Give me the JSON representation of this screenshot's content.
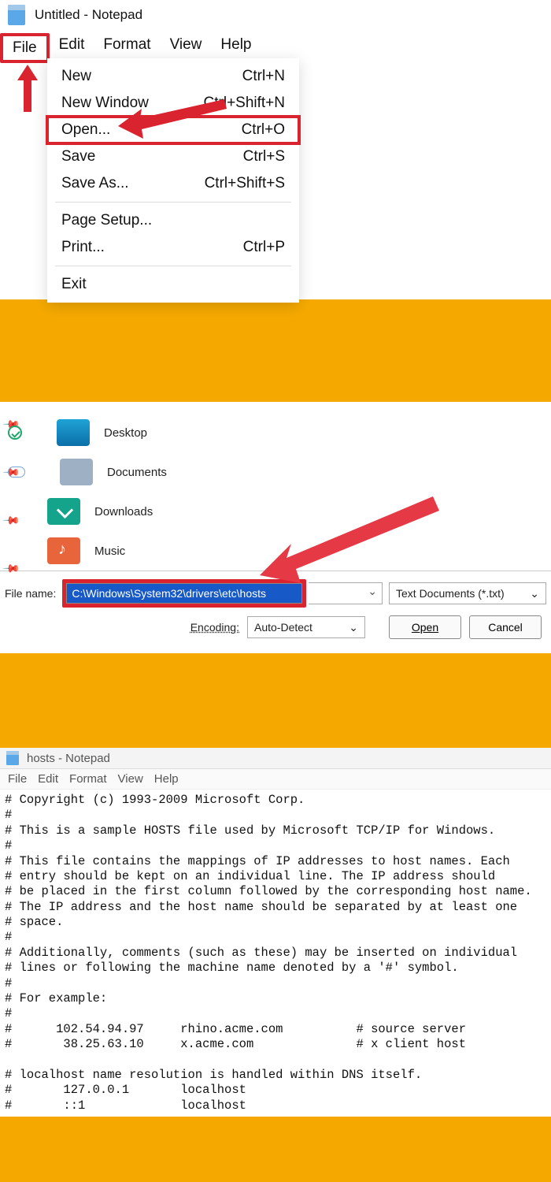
{
  "panel1": {
    "title": "Untitled - Notepad",
    "menubar": [
      "File",
      "Edit",
      "Format",
      "View",
      "Help"
    ],
    "dropdown": [
      {
        "label": "New",
        "accel": "Ctrl+N"
      },
      {
        "label": "New Window",
        "accel": "Ctrl+Shift+N"
      },
      {
        "label": "Open...",
        "accel": "Ctrl+O",
        "highlight": true
      },
      {
        "label": "Save",
        "accel": "Ctrl+S"
      },
      {
        "label": "Save As...",
        "accel": "Ctrl+Shift+S"
      },
      {
        "sep": true
      },
      {
        "label": "Page Setup...",
        "accel": ""
      },
      {
        "label": "Print...",
        "accel": "Ctrl+P"
      },
      {
        "sep": true
      },
      {
        "label": "Exit",
        "accel": ""
      }
    ]
  },
  "panel2": {
    "folders": [
      {
        "name": "Desktop",
        "icon": "f-desktop",
        "badge": "check"
      },
      {
        "name": "Documents",
        "icon": "f-docs",
        "badge": "cloud"
      },
      {
        "name": "Downloads",
        "icon": "f-down"
      },
      {
        "name": "Music",
        "icon": "f-music"
      }
    ],
    "file_name_label": "File name:",
    "file_name_value": "C:\\Windows\\System32\\drivers\\etc\\hosts",
    "type_filter": "Text Documents (*.txt)",
    "encoding_label": "Encoding:",
    "encoding_value": "Auto-Detect",
    "open_btn": "Open",
    "cancel_btn": "Cancel"
  },
  "panel3": {
    "title": "hosts - Notepad",
    "menubar": [
      "File",
      "Edit",
      "Format",
      "View",
      "Help"
    ],
    "body": "# Copyright (c) 1993-2009 Microsoft Corp.\n#\n# This is a sample HOSTS file used by Microsoft TCP/IP for Windows.\n#\n# This file contains the mappings of IP addresses to host names. Each\n# entry should be kept on an individual line. The IP address should\n# be placed in the first column followed by the corresponding host name.\n# The IP address and the host name should be separated by at least one\n# space.\n#\n# Additionally, comments (such as these) may be inserted on individual\n# lines or following the machine name denoted by a '#' symbol.\n#\n# For example:\n#\n#      102.54.94.97     rhino.acme.com          # source server\n#       38.25.63.10     x.acme.com              # x client host\n\n# localhost name resolution is handled within DNS itself.\n#       127.0.0.1       localhost\n#       ::1             localhost"
  }
}
